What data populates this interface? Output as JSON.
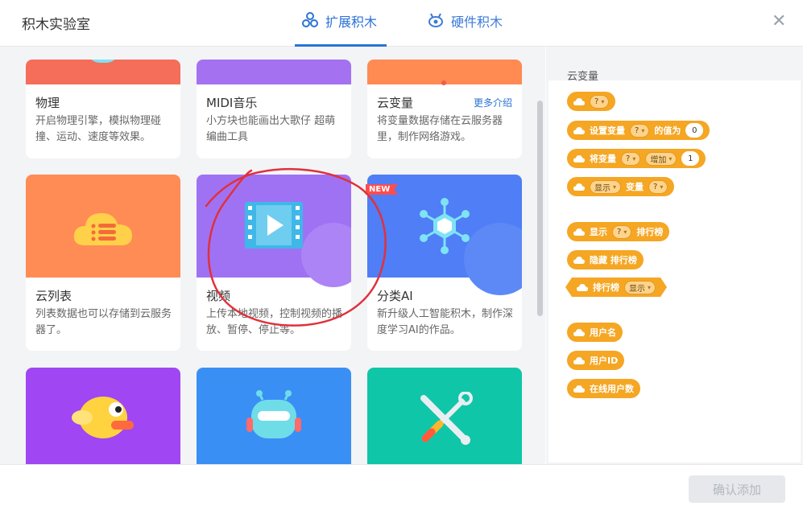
{
  "dialog": {
    "title": "积木实验室",
    "close_icon": "close-icon"
  },
  "tabs": [
    {
      "label": "扩展积木",
      "icon": "extension-blocks-icon",
      "active": true
    },
    {
      "label": "硬件积木",
      "icon": "robot-hardware-icon",
      "active": false
    }
  ],
  "cards_row1": [
    {
      "name": "物理",
      "desc": "开启物理引擎，模拟物理碰撞、运动、速度等效果。",
      "banner_color": "#f46e5a"
    },
    {
      "name": "MIDI音乐",
      "desc": "小方块也能画出大歌仔 超萌编曲工具",
      "banner_color": "#a472f0"
    },
    {
      "name": "云变量",
      "more": "更多介绍",
      "desc": "将变量数据存储在云服务器里，制作网络游戏。",
      "banner_color": "#ff8a52"
    }
  ],
  "cards_row2": [
    {
      "name": "云列表",
      "desc": "列表数据也可以存储到云服务器了。",
      "icon": "cloud-list-icon",
      "banner_color": "#ff8c54"
    },
    {
      "name": "视频",
      "desc": "上传本地视频，控制视频的播放、暂停、停止等。",
      "icon": "video-play-icon",
      "banner_color": "#9f72f4"
    },
    {
      "name": "分类AI",
      "desc": "新升级人工智能积木，制作深度学习AI的作品。",
      "icon": "ai-network-icon",
      "badge": "NEW",
      "banner_color": "#4f7ef6"
    }
  ],
  "cards_row3": [
    {
      "icon": "flappy-bird-icon",
      "banner_color": "#a046f2"
    },
    {
      "icon": "robot-icon",
      "banner_color": "#3a8ff5"
    },
    {
      "icon": "tools-wrench-icon",
      "banner_color": "#10c6a8"
    }
  ],
  "right_panel": {
    "title": "云变量",
    "blocks": {
      "b1": {
        "dd": "?"
      },
      "b2": {
        "label1": "设置变量",
        "dd": "?",
        "label2": "的值为",
        "num": "0"
      },
      "b3": {
        "label1": "将变量",
        "dd": "?",
        "dd2": "增加",
        "num": "1"
      },
      "b4": {
        "dd": "显示",
        "label1": "变量",
        "dd2": "?"
      },
      "b5": {
        "label1": "显示",
        "dd": "?",
        "label2": "排行榜"
      },
      "b6": {
        "label1": "隐藏 排行榜"
      },
      "b7": {
        "label1": "排行榜",
        "dd": "显示"
      },
      "b8": {
        "label1": "用户名"
      },
      "b9": {
        "label1": "用户ID"
      },
      "b10": {
        "label1": "在线用户数"
      }
    }
  },
  "footer": {
    "confirm_label": "确认添加"
  },
  "colors": {
    "accent": "#2a73d6",
    "block": "#f5a623",
    "annotation": "#e0313c"
  }
}
